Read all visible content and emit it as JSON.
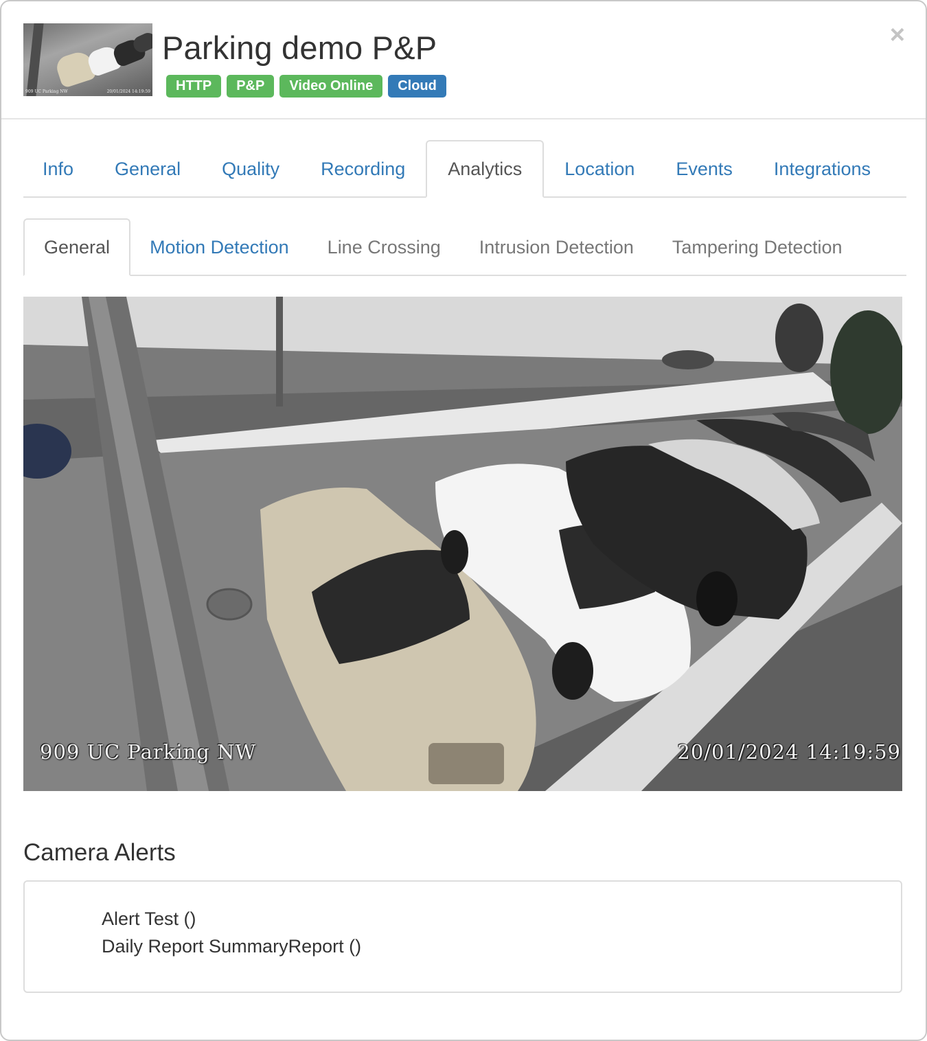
{
  "header": {
    "title": "Parking demo P&P",
    "close_glyph": "×",
    "thumbnail_caption_left": "909 UC Parking NW",
    "thumbnail_caption_right": "20/01/2024 14:19:59",
    "badges": [
      {
        "label": "HTTP",
        "color": "#5cb85c"
      },
      {
        "label": "P&P",
        "color": "#5cb85c"
      },
      {
        "label": "Video Online",
        "color": "#5cb85c"
      },
      {
        "label": "Cloud",
        "color": "#337ab7"
      }
    ]
  },
  "main_tabs": [
    {
      "label": "Info"
    },
    {
      "label": "General"
    },
    {
      "label": "Quality"
    },
    {
      "label": "Recording"
    },
    {
      "label": "Analytics",
      "active": true
    },
    {
      "label": "Location"
    },
    {
      "label": "Events"
    },
    {
      "label": "Integrations"
    }
  ],
  "sub_tabs": [
    {
      "label": "General",
      "active": true
    },
    {
      "label": "Motion Detection"
    },
    {
      "label": "Line Crossing",
      "disabled": true
    },
    {
      "label": "Intrusion Detection",
      "disabled": true
    },
    {
      "label": "Tampering Detection",
      "disabled": true
    }
  ],
  "camera": {
    "overlay_name": "909 UC Parking NW",
    "overlay_time": "20/01/2024 14:19:59"
  },
  "alerts": {
    "title": "Camera Alerts",
    "items": [
      {
        "label": "Alert Test ()"
      },
      {
        "label": "Daily Report SummaryReport ()"
      }
    ]
  },
  "colors": {
    "link": "#337ab7",
    "badge_green": "#5cb85c",
    "badge_blue": "#337ab7"
  }
}
